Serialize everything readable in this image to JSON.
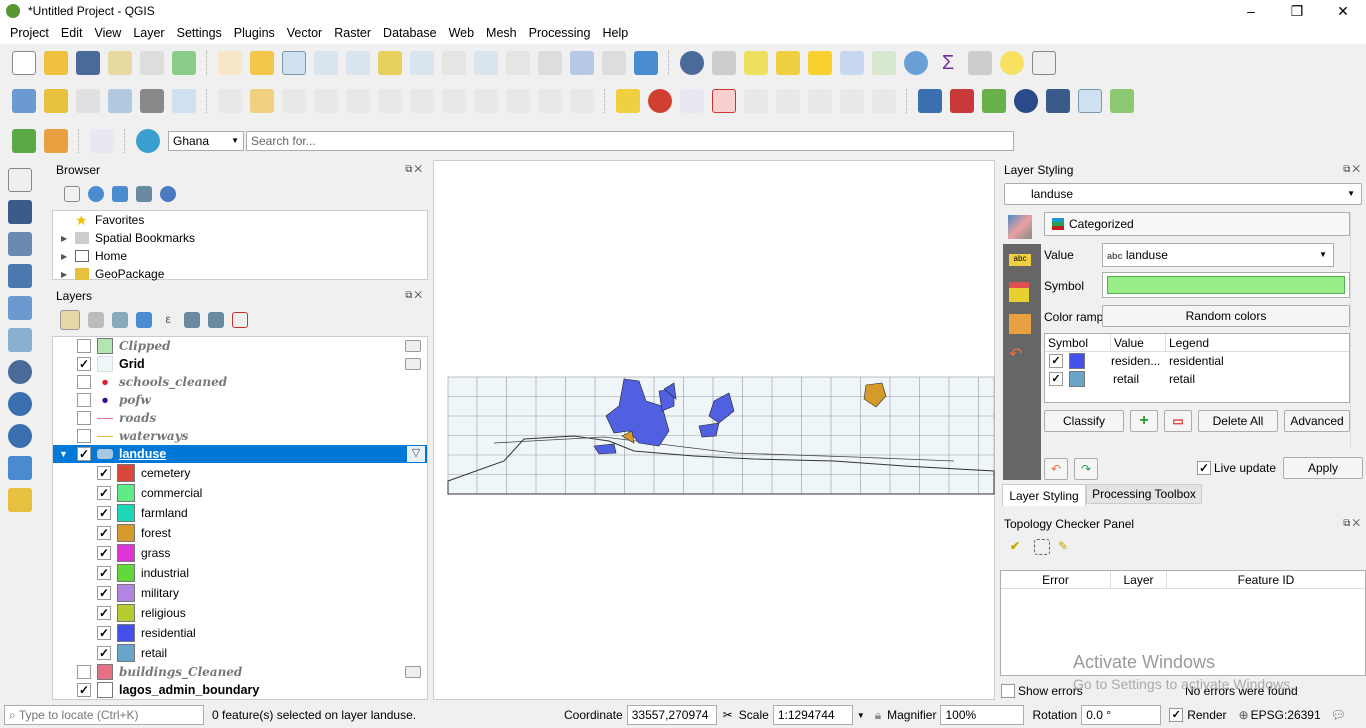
{
  "window": {
    "title": "*Untitled Project - QGIS",
    "controls": [
      "–",
      "❐",
      "✕"
    ]
  },
  "menu": [
    "Project",
    "Edit",
    "View",
    "Layer",
    "Settings",
    "Plugins",
    "Vector",
    "Raster",
    "Database",
    "Web",
    "Mesh",
    "Processing",
    "Help"
  ],
  "toolbar3": {
    "locator_value": "Ghana",
    "search_placeholder": "Search for..."
  },
  "browser": {
    "title": "Browser",
    "items": [
      "Favorites",
      "Spatial Bookmarks",
      "Home",
      "GeoPackage"
    ]
  },
  "layers": {
    "title": "Layers",
    "items": [
      {
        "name": "Clipped",
        "checked": false,
        "style": "italic",
        "color": "#b2e5b2"
      },
      {
        "name": "Grid",
        "checked": true,
        "style": "bold",
        "color": "#eef6fa"
      },
      {
        "name": "schools_cleaned",
        "checked": false,
        "style": "italic",
        "color": "#e0202f"
      },
      {
        "name": "pofw",
        "checked": false,
        "style": "italic",
        "color": "#3a0d8c"
      },
      {
        "name": "roads",
        "checked": false,
        "style": "italic",
        "color": "#e6709a"
      },
      {
        "name": "waterways",
        "checked": false,
        "style": "italic",
        "color": "#e8b830"
      },
      {
        "name": "landuse",
        "checked": true,
        "style": "selected"
      },
      {
        "name": "buildings_Cleaned",
        "checked": false,
        "style": "italic",
        "color": "#e57088"
      },
      {
        "name": "lagos_admin_boundary",
        "checked": true,
        "style": "bold",
        "color": "#ffffff"
      }
    ],
    "categories": [
      {
        "label": "cemetery",
        "color": "#d9463a"
      },
      {
        "label": "commercial",
        "color": "#62e988"
      },
      {
        "label": "farmland",
        "color": "#1fd6b9"
      },
      {
        "label": "forest",
        "color": "#d49a2a"
      },
      {
        "label": "grass",
        "color": "#de35d8"
      },
      {
        "label": "industrial",
        "color": "#62d93b"
      },
      {
        "label": "military",
        "color": "#b185e0"
      },
      {
        "label": "religious",
        "color": "#b6cc30"
      },
      {
        "label": "residential",
        "color": "#4450ea"
      },
      {
        "label": "retail",
        "color": "#6aa4c8"
      }
    ]
  },
  "styling": {
    "title": "Layer Styling",
    "layer": "landuse",
    "renderer": "Categorized",
    "value_label": "Value",
    "value": "landuse",
    "value_type": "abc",
    "symbol_label": "Symbol",
    "symbol_color": "#98ed86",
    "ramp_label": "Color ramp",
    "ramp": "Random colors",
    "columns": [
      "Symbol",
      "Value",
      "Legend"
    ],
    "rows": [
      {
        "value": "residen...",
        "legend": "residential",
        "color": "#4450ea"
      },
      {
        "value": "retail",
        "legend": "retail",
        "color": "#6aa4c8"
      }
    ],
    "classify": "Classify",
    "delete_all": "Delete All",
    "advanced": "Advanced",
    "live_update": "Live update",
    "apply": "Apply",
    "tabs": [
      "Layer Styling",
      "Processing Toolbox"
    ]
  },
  "topology": {
    "title": "Topology Checker Panel",
    "columns": [
      "Error",
      "Layer",
      "Feature ID"
    ],
    "show_errors": "Show errors",
    "status": "No errors were found"
  },
  "watermark": {
    "line1": "Activate Windows",
    "line2": "Go to Settings to activate Windows."
  },
  "status": {
    "locate_placeholder": "Type to locate (Ctrl+K)",
    "message": "0 feature(s) selected on layer landuse.",
    "coordinate_label": "Coordinate",
    "coordinate": "33557,270974",
    "scale_label": "Scale",
    "scale": "1:1294744",
    "magnifier_label": "Magnifier",
    "magnifier": "100%",
    "rotation_label": "Rotation",
    "rotation": "0.0 °",
    "render_label": "Render",
    "crs": "EPSG:26391"
  }
}
